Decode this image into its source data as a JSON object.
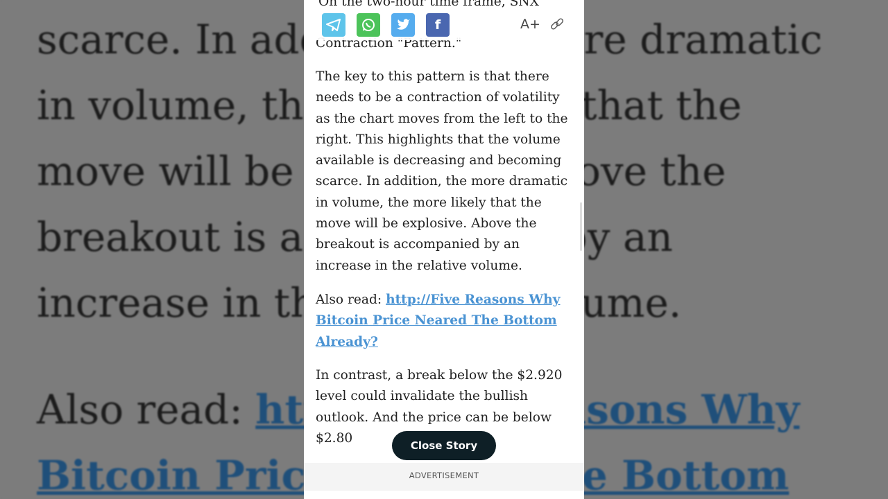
{
  "background": {
    "lines": [
      "scarce. In addition, the more dramatic",
      "in volume, the more likely that the",
      "move will be explosive. Above the",
      "breakout is accompanied by an",
      "increase in the relative volume."
    ],
    "also_read_prefix": "Also read: ",
    "also_read_link_1": "http://Five Reasons Why",
    "also_read_link_2": "Bitcoin Price Neared The Bottom"
  },
  "article": {
    "top_line": "On the two-hour time frame, SNX",
    "second_line": "Contraction \"Pattern.\"",
    "paragraph1": [
      "The key to this pattern is that there",
      "needs to be a contraction of volatility",
      "as the chart moves from the left to the",
      "right. This highlights that the volume",
      "available is decreasing and becoming",
      "scarce. In addition, the more dramatic",
      "in volume, the more likely that the",
      "move will be explosive. Above the",
      "breakout is accompanied by an",
      "increase in the relative volume."
    ],
    "also_read_prefix": "Also read: ",
    "also_read_link": [
      "http://Five Reasons Why",
      "Bitcoin Price Neared The Bottom",
      "Already?"
    ],
    "paragraph2": [
      "In contrast, a break below the $2.920",
      "level could invalidate the bullish",
      "outlook. And the price can be below",
      "$2.80"
    ]
  },
  "share": {
    "icons": [
      "telegram-icon",
      "whatsapp-icon",
      "twitter-icon",
      "facebook-icon"
    ],
    "colors": {
      "telegram": "#5ec4ea",
      "whatsapp": "#4cc35a",
      "twitter": "#55acee",
      "facebook": "#4a67b0"
    },
    "font_size_label": "A+",
    "link_icon": "link-icon"
  },
  "close_story": "Close Story",
  "advertisement": "ADVERTISEMENT"
}
